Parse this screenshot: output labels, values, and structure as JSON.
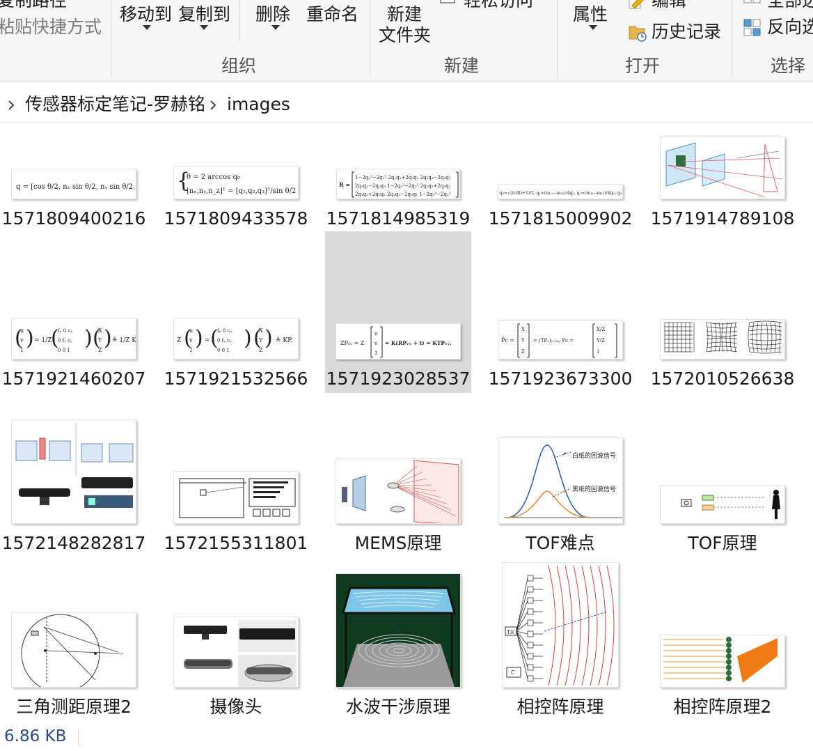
{
  "ribbon": {
    "copy_path": "复制路径",
    "paste_shortcut": "粘贴快捷方式",
    "move_to": "移动到",
    "copy_to": "复制到",
    "delete": "删除",
    "rename": "重命名",
    "new_folder_line1": "新建",
    "new_folder_line2": "文件夹",
    "easy_access": "轻松访问",
    "properties": "属性",
    "edit": "编辑",
    "history": "历史记录",
    "select_all": "全部选择",
    "invert_selection": "反向选择",
    "group_organize": "组织",
    "group_new": "新建",
    "group_open": "打开",
    "group_select": "选择"
  },
  "address": {
    "crumbs": [
      "传感器标定笔记-罗赫铭",
      "images"
    ]
  },
  "files": [
    {
      "name": "1571809400216",
      "kind": "eq-wide"
    },
    {
      "name": "1571809433578",
      "kind": "eq-brace"
    },
    {
      "name": "1571814985319",
      "kind": "eq-matrix"
    },
    {
      "name": "1571815009902",
      "kind": "eq-thin"
    },
    {
      "name": "1571914789108",
      "kind": "diagram-planes"
    },
    {
      "name": "1571921460207",
      "kind": "eq-camera"
    },
    {
      "name": "1571921532566",
      "kind": "eq-camera2"
    },
    {
      "name": "1571923028537",
      "kind": "eq-zp",
      "selected": true
    },
    {
      "name": "1571923673300",
      "kind": "eq-pc"
    },
    {
      "name": "1572010526638",
      "kind": "grids"
    },
    {
      "name": "1572148282817",
      "kind": "kinect"
    },
    {
      "name": "1572155311801",
      "kind": "depth-diagram"
    },
    {
      "name": "MEMS原理",
      "kind": "mems"
    },
    {
      "name": "TOF难点",
      "kind": "tof-curve"
    },
    {
      "name": "TOF原理",
      "kind": "tof"
    },
    {
      "name": "三角测距原理2",
      "kind": "triangle"
    },
    {
      "name": "摄像头",
      "kind": "cameras"
    },
    {
      "name": "水波干涉原理",
      "kind": "water"
    },
    {
      "name": "相控阵原理",
      "kind": "phased"
    },
    {
      "name": "相控阵原理2",
      "kind": "phased2"
    }
  ],
  "thumb_text": {
    "tof_white": "白纸的回波信号",
    "tof_black": "黑纸的回波信号"
  },
  "status": {
    "size": "6.86 KB"
  },
  "colors": {
    "selection": "#d9d9d9",
    "status_text": "#2b4a8a",
    "ribbon_bg": "#f5f6f7"
  }
}
